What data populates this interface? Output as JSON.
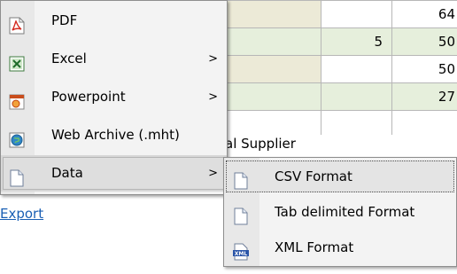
{
  "table": {
    "rows": [
      {
        "tone": "tan",
        "col2": "",
        "col3": "64"
      },
      {
        "tone": "green",
        "col2": "5",
        "col3": "50"
      },
      {
        "tone": "tan",
        "col2": "",
        "col3": "50"
      },
      {
        "tone": "green",
        "col2": "",
        "col3": "27"
      }
    ],
    "supplier_text": "al Supplier"
  },
  "export_link": "Export",
  "menu": {
    "items": [
      {
        "label": "PDF",
        "icon": "pdf-icon",
        "has_submenu": false
      },
      {
        "label": "Excel",
        "icon": "excel-icon",
        "has_submenu": true
      },
      {
        "label": "Powerpoint",
        "icon": "powerpoint-icon",
        "has_submenu": true
      },
      {
        "label": "Web Archive (.mht)",
        "icon": "web-archive-icon",
        "has_submenu": false
      },
      {
        "label": "Data",
        "icon": "data-file-icon",
        "has_submenu": true
      }
    ],
    "arrow": ">"
  },
  "submenu": {
    "items": [
      {
        "label": "CSV Format",
        "icon": "csv-file-icon"
      },
      {
        "label": "Tab delimited Format",
        "icon": "tab-file-icon"
      },
      {
        "label": "XML Format",
        "icon": "xml-icon",
        "badge": "XML"
      }
    ]
  },
  "colors": {
    "link": "#1a5fb4",
    "menu_bg": "#f3f3f3",
    "row_tan": "#ecead7",
    "row_green": "#e6efdc"
  }
}
